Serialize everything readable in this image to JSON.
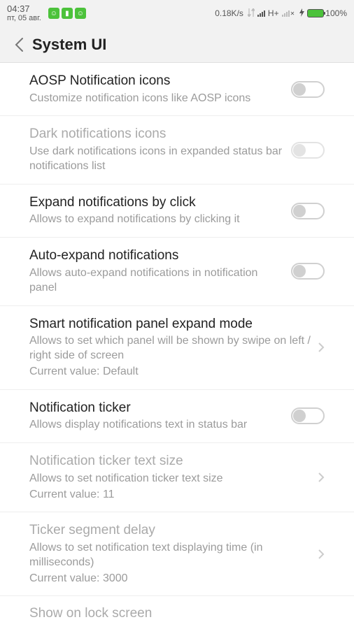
{
  "status_bar": {
    "time": "04:37",
    "date": "пт, 05 авг.",
    "speed": "0.18K/s",
    "net_type": "H+",
    "battery_pct": "100%"
  },
  "header": {
    "title": "System UI"
  },
  "settings": [
    {
      "title": "AOSP Notification icons",
      "sub": "Customize notification icons like AOSP icons",
      "type": "toggle",
      "disabled": false
    },
    {
      "title": "Dark notifications icons",
      "sub": "Use dark notifications icons in expanded status bar notifications list",
      "type": "toggle",
      "disabled": true
    },
    {
      "title": "Expand notifications by click",
      "sub": "Allows to expand notifications by clicking it",
      "type": "toggle",
      "disabled": false
    },
    {
      "title": "Auto-expand notifications",
      "sub": "Allows auto-expand notifications in notification panel",
      "type": "toggle",
      "disabled": false
    },
    {
      "title": "Smart notification panel expand mode",
      "sub": "Allows to set which panel will be shown by swipe on left / right side of screen",
      "curval": "Current value: Default",
      "type": "link",
      "disabled": false
    },
    {
      "title": "Notification ticker",
      "sub": "Allows display notifications text in status bar",
      "type": "toggle",
      "disabled": false
    },
    {
      "title": "Notification ticker text size",
      "sub": "Allows to set notification ticker text size",
      "curval": "Current value: 11",
      "type": "link",
      "disabled": true
    },
    {
      "title": "Ticker segment delay",
      "sub": "Allows to set notification text displaying time (in milliseconds)",
      "curval": "Current value: 3000",
      "type": "link",
      "disabled": true
    }
  ],
  "partial_title": "Show on lock screen"
}
